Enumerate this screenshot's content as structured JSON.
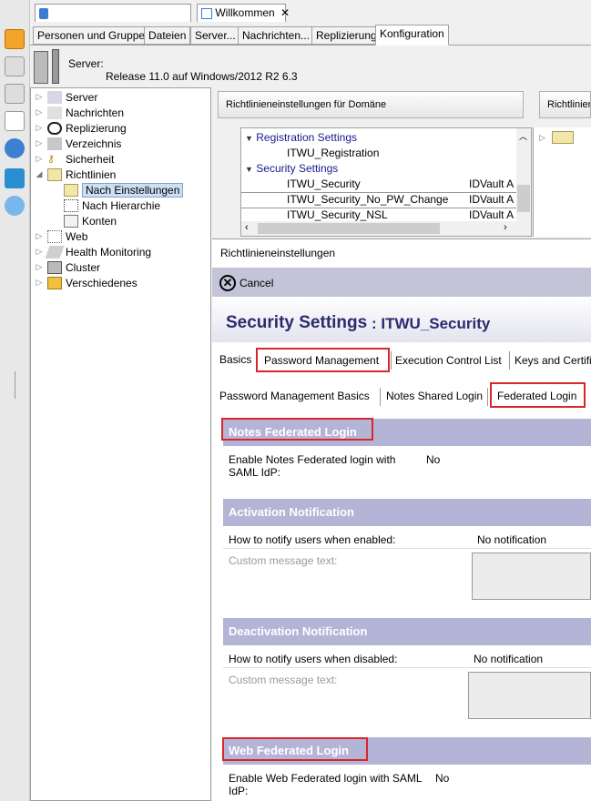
{
  "doc_tabs": {
    "tab1_label": "",
    "tab2_label": "Willkommen"
  },
  "sub_tabs": [
    "Personen und Gruppen",
    "Dateien",
    "Server...",
    "Nachrichten...",
    "Replizierung",
    "Konfiguration"
  ],
  "server": {
    "label": "Server:",
    "release": "Release 11.0 auf Windows/2012 R2 6.3"
  },
  "tree": {
    "items": [
      "Server",
      "Nachrichten",
      "Replizierung",
      "Verzeichnis",
      "Sicherheit",
      "Richtlinien",
      "Nach Einstellungen",
      "Nach Hierarchie",
      "Konten",
      "Web",
      "Health Monitoring",
      "Cluster",
      "Verschiedenes"
    ]
  },
  "policy_panel": {
    "header": "Richtlinieneinstellungen für Domäne",
    "right_header": "Richtlinienh",
    "groups": [
      "Registration Settings",
      "Security Settings"
    ],
    "rows": [
      {
        "name": "ITWU_Registration",
        "owner": ""
      },
      {
        "name": "ITWU_Security",
        "owner": "IDVault A"
      },
      {
        "name": "ITWU_Security_No_PW_Change",
        "owner": "IDVault A"
      },
      {
        "name": "ITWU_Security_NSL",
        "owner": "IDVault A"
      }
    ]
  },
  "form": {
    "pane_title": "Richtlinieneinstellungen",
    "cancel_label": "Cancel",
    "doc_title": "Security Settings",
    "doc_subtitle": ": ITWU_Security",
    "tabs": [
      "Basics",
      "Password Management",
      "Execution Control List",
      "Keys and Certifi"
    ],
    "subtabs": [
      "Password Management Basics",
      "Notes Shared Login",
      "Federated Login"
    ],
    "sections": {
      "notes_fed": "Notes Federated Login",
      "activation": "Activation Notification",
      "deactivation": "Deactivation Notification",
      "web_fed": "Web Federated Login"
    },
    "fields": {
      "enable_notes_label": "Enable Notes Federated login with SAML IdP:",
      "enable_notes_value": "No",
      "notify_enabled_label": "How to notify users when enabled:",
      "notify_enabled_value": "No notification",
      "custom_msg_label": "Custom message text:",
      "notify_disabled_label": "How to notify users when disabled:",
      "notify_disabled_value": "No notification",
      "custom_msg_label2": "Custom message text:",
      "enable_web_label": "Enable Web Federated login with SAML IdP:",
      "enable_web_value": "No"
    }
  },
  "colors": {
    "section_bg": "#b4b4d6",
    "highlight": "#d9262d",
    "title_color": "#2b2b6e"
  }
}
